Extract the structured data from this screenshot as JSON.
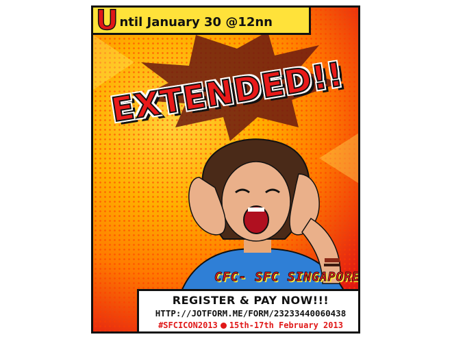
{
  "poster": {
    "top_initial": "U",
    "top_text": "ntil January 30 @12nn",
    "headline": "EXTENDED!!",
    "org": "CFC- SFC SINGAPORE",
    "register": "REGISTER & PAY NOW!!!",
    "url": "HTTP://JOTFORM.ME/FORM/23233440060438",
    "hashtag": "#SFCICON2013",
    "dates": "15th-17th February 2013"
  },
  "colors": {
    "accent_red": "#e01818",
    "accent_yellow": "#ffe23a",
    "ink": "#111111"
  }
}
